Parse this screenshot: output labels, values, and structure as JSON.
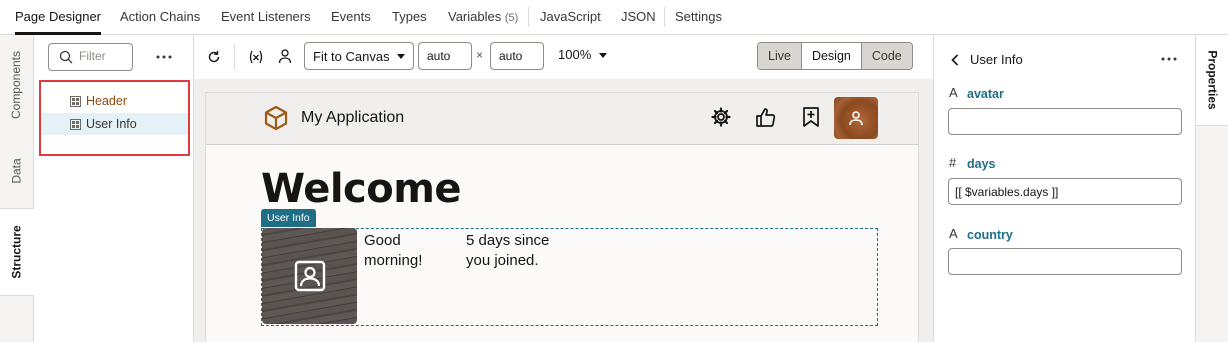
{
  "top_tabs": {
    "page_designer": "Page Designer",
    "action_chains": "Action Chains",
    "event_listeners": "Event Listeners",
    "events": "Events",
    "types": "Types",
    "variables": "Variables",
    "variables_count": "(5)",
    "javascript": "JavaScript",
    "json": "JSON",
    "settings": "Settings"
  },
  "left_rail": {
    "components": "Components",
    "data": "Data",
    "structure": "Structure"
  },
  "structure": {
    "filter_placeholder": "Filter",
    "items": [
      {
        "label": "Header"
      },
      {
        "label": "User Info"
      }
    ]
  },
  "toolbar": {
    "fit_select": "Fit to Canvas",
    "width_value": "auto",
    "height_value": "auto",
    "times": "×",
    "zoom": "100%",
    "modes": [
      "Live",
      "Design",
      "Code"
    ]
  },
  "canvas": {
    "app_title": "My Application",
    "welcome": "Welcome",
    "component_tag": "User Info",
    "greeting": "Good morning!",
    "since": "5 days since you joined."
  },
  "properties": {
    "title": "User Info",
    "fields": [
      {
        "type_icon": "A",
        "label": "avatar",
        "value": ""
      },
      {
        "type_icon": "#",
        "label": "days",
        "value": "[[ $variables.days ]]"
      },
      {
        "type_icon": "A",
        "label": "country",
        "value": ""
      }
    ]
  },
  "right_rail": {
    "properties": "Properties"
  },
  "colors": {
    "accent": "#1f6e86",
    "highlight": "#e0393e",
    "tree_label": "#8a4a10"
  }
}
